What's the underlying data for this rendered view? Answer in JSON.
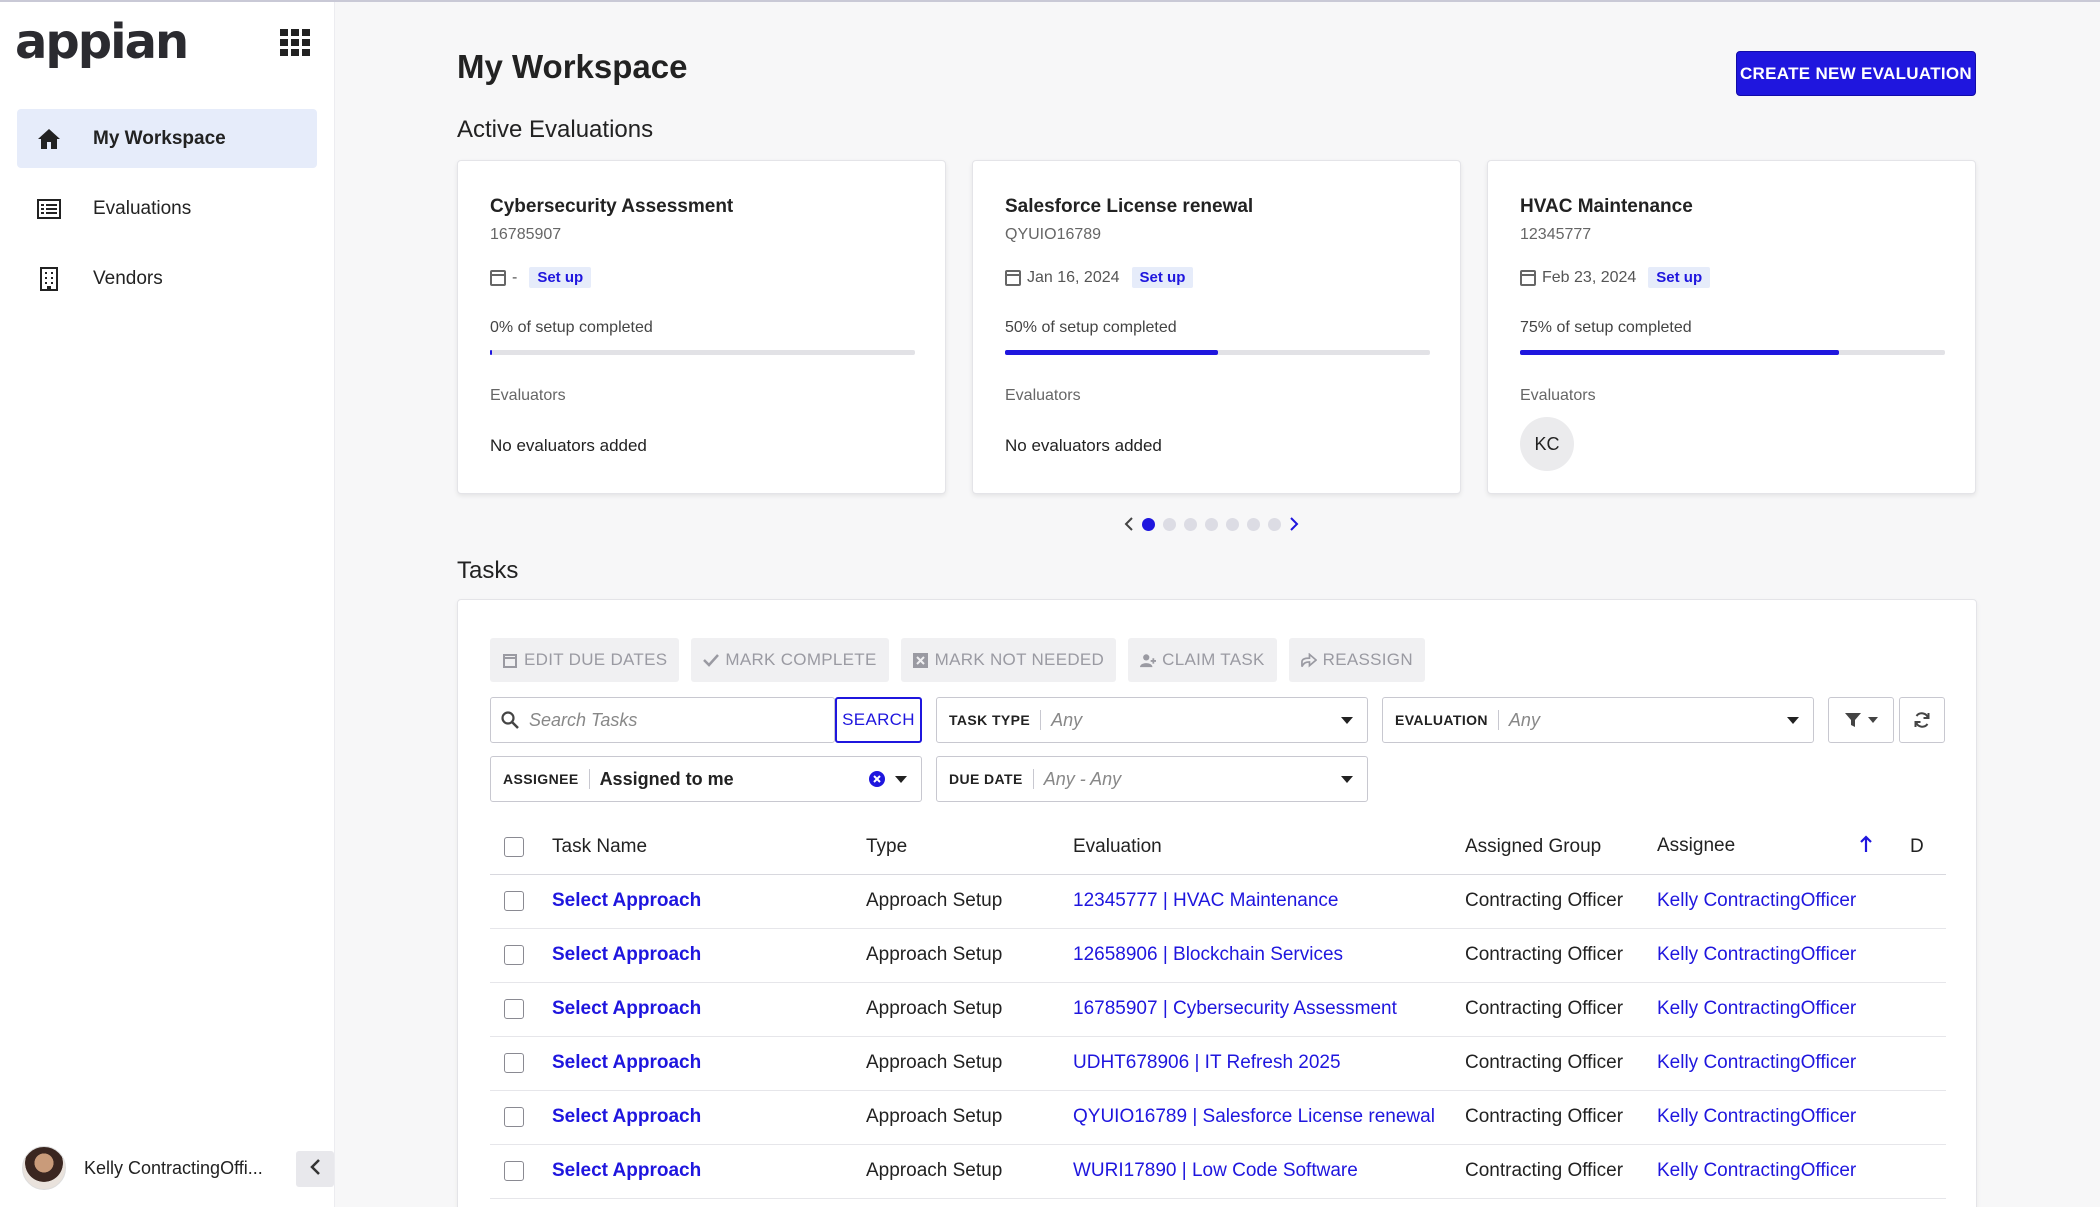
{
  "app": {
    "logo_text": "appian",
    "apps_icon": "grid-icon"
  },
  "sidebar": {
    "items": [
      {
        "label": "My Workspace",
        "icon": "home-icon",
        "active": true
      },
      {
        "label": "Evaluations",
        "icon": "list-icon",
        "active": false
      },
      {
        "label": "Vendors",
        "icon": "building-icon",
        "active": false
      }
    ],
    "user_name": "Kelly ContractingOffi..."
  },
  "header": {
    "title": "My Workspace",
    "create_button": "CREATE NEW EVALUATION"
  },
  "active_evaluations": {
    "heading": "Active Evaluations",
    "cards": [
      {
        "title": "Cybersecurity Assessment",
        "id": "16785907",
        "date": "-",
        "status": "Set up",
        "progress_text": "0% of setup completed",
        "progress": 0.005,
        "evaluators_label": "Evaluators",
        "evaluators": "No evaluators added"
      },
      {
        "title": "Salesforce License renewal",
        "id": "QYUIO16789",
        "date": "Jan 16, 2024",
        "status": "Set up",
        "progress_text": "50% of setup completed",
        "progress": 0.5,
        "evaluators_label": "Evaluators",
        "evaluators": "No evaluators added"
      },
      {
        "title": "HVAC Maintenance",
        "id": "12345777",
        "date": "Feb 23, 2024",
        "status": "Set up",
        "progress_text": "75% of setup completed",
        "progress": 0.75,
        "evaluators_label": "Evaluators",
        "evaluator_initials": "KC"
      }
    ],
    "pager": {
      "total": 7,
      "current": 1
    }
  },
  "tasks": {
    "heading": "Tasks",
    "toolbar": {
      "edit_due_dates": "EDIT DUE DATES",
      "mark_complete": "MARK COMPLETE",
      "mark_not_needed": "MARK NOT NEEDED",
      "claim_task": "CLAIM TASK",
      "reassign": "REASSIGN"
    },
    "filters": {
      "search_placeholder": "Search Tasks",
      "search_button": "SEARCH",
      "task_type_label": "TASK TYPE",
      "task_type_value": "Any",
      "evaluation_label": "EVALUATION",
      "evaluation_value": "Any",
      "assignee_label": "ASSIGNEE",
      "assignee_value": "Assigned to me",
      "due_date_label": "DUE DATE",
      "due_date_value": "Any - Any"
    },
    "columns": [
      "Task Name",
      "Type",
      "Evaluation",
      "Assigned Group",
      "Assignee",
      "D"
    ],
    "rows": [
      {
        "task": "Select Approach",
        "type": "Approach Setup",
        "evaluation": "12345777 | HVAC Maintenance",
        "group": "Contracting Officer",
        "assignee": "Kelly ContractingOfficer"
      },
      {
        "task": "Select Approach",
        "type": "Approach Setup",
        "evaluation": "12658906 | Blockchain Services",
        "group": "Contracting Officer",
        "assignee": "Kelly ContractingOfficer"
      },
      {
        "task": "Select Approach",
        "type": "Approach Setup",
        "evaluation": "16785907 | Cybersecurity Assessment",
        "group": "Contracting Officer",
        "assignee": "Kelly ContractingOfficer"
      },
      {
        "task": "Select Approach",
        "type": "Approach Setup",
        "evaluation": "UDHT678906 | IT Refresh 2025",
        "group": "Contracting Officer",
        "assignee": "Kelly ContractingOfficer"
      },
      {
        "task": "Select Approach",
        "type": "Approach Setup",
        "evaluation": "QYUIO16789 | Salesforce License renewal",
        "group": "Contracting Officer",
        "assignee": "Kelly ContractingOfficer"
      },
      {
        "task": "Select Approach",
        "type": "Approach Setup",
        "evaluation": "WURI17890 | Low Code Software",
        "group": "Contracting Officer",
        "assignee": "Kelly ContractingOfficer"
      }
    ]
  },
  "colors": {
    "accent": "#1f16de",
    "active_nav_bg": "#e6ecfa"
  }
}
